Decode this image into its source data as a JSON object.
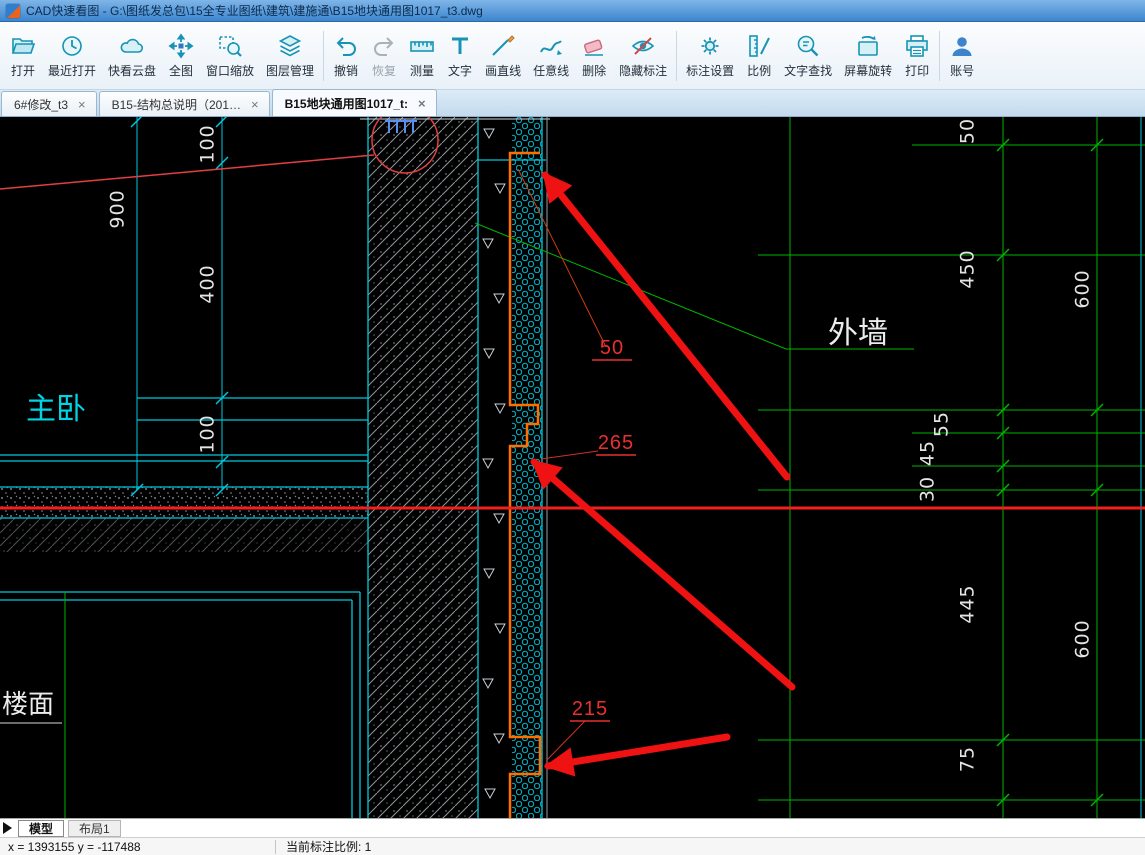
{
  "window": {
    "title": "CAD快速看图 - G:\\图纸发总包\\15全专业图纸\\建筑\\建施通\\B15地块通用图1017_t3.dwg"
  },
  "toolbar": {
    "items": [
      {
        "label": "打开",
        "icon": "open-folder"
      },
      {
        "label": "最近打开",
        "icon": "recent-clock"
      },
      {
        "label": "快看云盘",
        "icon": "cloud-disk"
      },
      {
        "label": "全图",
        "icon": "full-view"
      },
      {
        "label": "窗口缩放",
        "icon": "window-zoom"
      },
      {
        "label": "图层管理",
        "icon": "layer-manager"
      },
      {
        "label": "撤销",
        "icon": "undo-arrow"
      },
      {
        "label": "恢复",
        "icon": "redo-arrow"
      },
      {
        "label": "测量",
        "icon": "measure-ruler"
      },
      {
        "label": "文字",
        "icon": "text-tool"
      },
      {
        "label": "画直线",
        "icon": "draw-line"
      },
      {
        "label": "任意线",
        "icon": "freehand-line"
      },
      {
        "label": "删除",
        "icon": "eraser"
      },
      {
        "label": "隐藏标注",
        "icon": "hide-annotation-eye"
      },
      {
        "label": "标注设置",
        "icon": "annotation-settings-gear"
      },
      {
        "label": "比例",
        "icon": "scale-ruler"
      },
      {
        "label": "文字查找",
        "icon": "text-search-magnifier"
      },
      {
        "label": "屏幕旋转",
        "icon": "screen-rotate"
      },
      {
        "label": "打印",
        "icon": "printer"
      },
      {
        "label": "账号",
        "icon": "account-person"
      }
    ]
  },
  "doc_tabs": [
    {
      "label": "6#修改_t3"
    },
    {
      "label": "B15-结构总说明（201…"
    },
    {
      "label": "B15地块通用图1017_t:"
    }
  ],
  "icons": {
    "close": "×"
  },
  "drawing": {
    "room_label": "主卧",
    "wall_label": "外墙",
    "floor_label": "楼面",
    "dims_left": [
      "900",
      "100",
      "400",
      "100"
    ],
    "dims_right": [
      "50",
      "450",
      "600",
      "55",
      "45",
      "30",
      "445",
      "600",
      "75"
    ],
    "red_labels": [
      "50",
      "265",
      "215"
    ]
  },
  "sheet_tabs": [
    {
      "label": "模型"
    },
    {
      "label": "布局1"
    }
  ],
  "status": {
    "coordinates": "x = 1393155  y = -117488",
    "scale_label": "当前标注比例: 1"
  }
}
